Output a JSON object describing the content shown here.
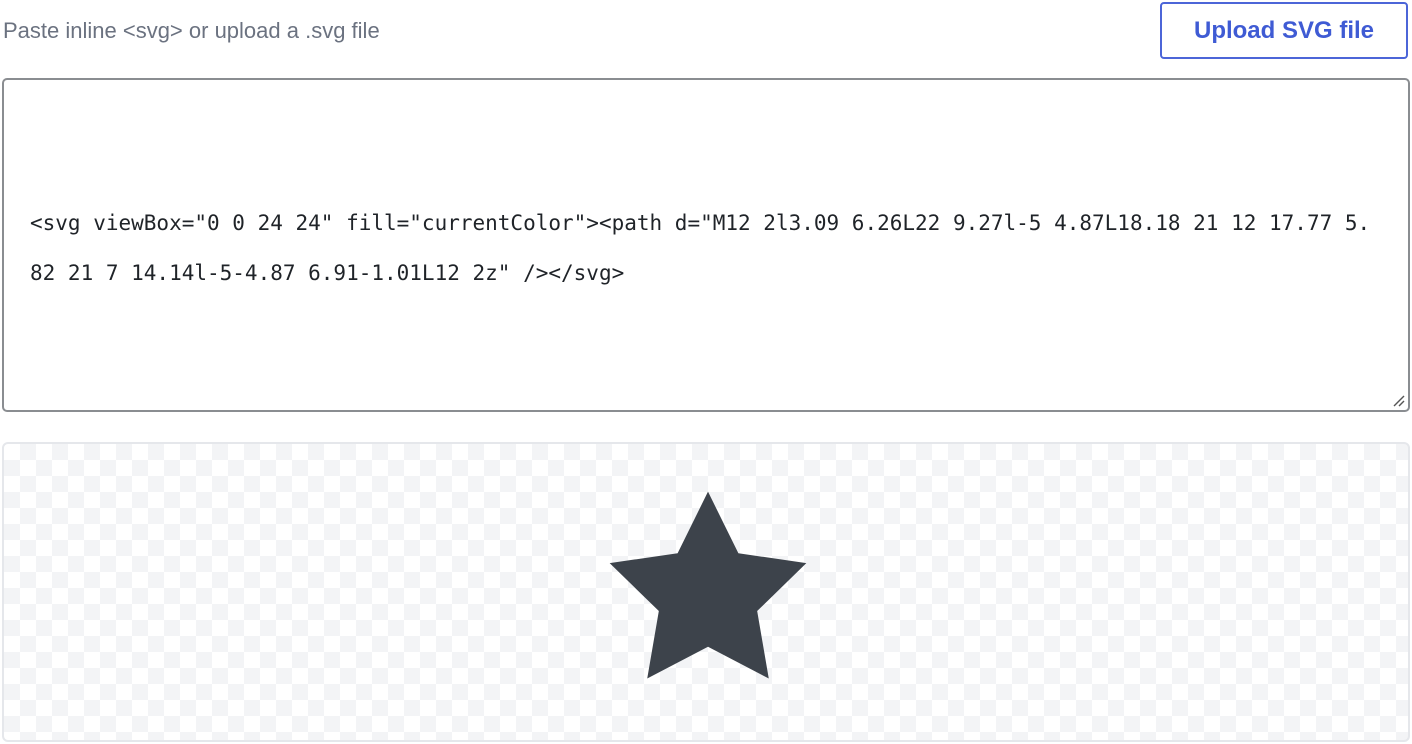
{
  "header": {
    "hint_text": "Paste inline <svg> or upload a .svg file",
    "upload_button_label": "Upload SVG file"
  },
  "editor": {
    "value": "<svg viewBox=\"0 0 24 24\" fill=\"currentColor\"><path d=\"M12 2l3.09 6.26L22 9.27l-5 4.87L18.18 21 12 17.77 5.82 21 7 14.14l-5-4.87 6.91-1.01L12 2z\" /></svg>"
  },
  "preview": {
    "icon": "star-icon",
    "fill_color": "#3d434b",
    "background": "checkerboard"
  },
  "colors": {
    "accent": "#3f5bd4",
    "muted_text": "#6b7280",
    "border": "#8a8d91"
  }
}
